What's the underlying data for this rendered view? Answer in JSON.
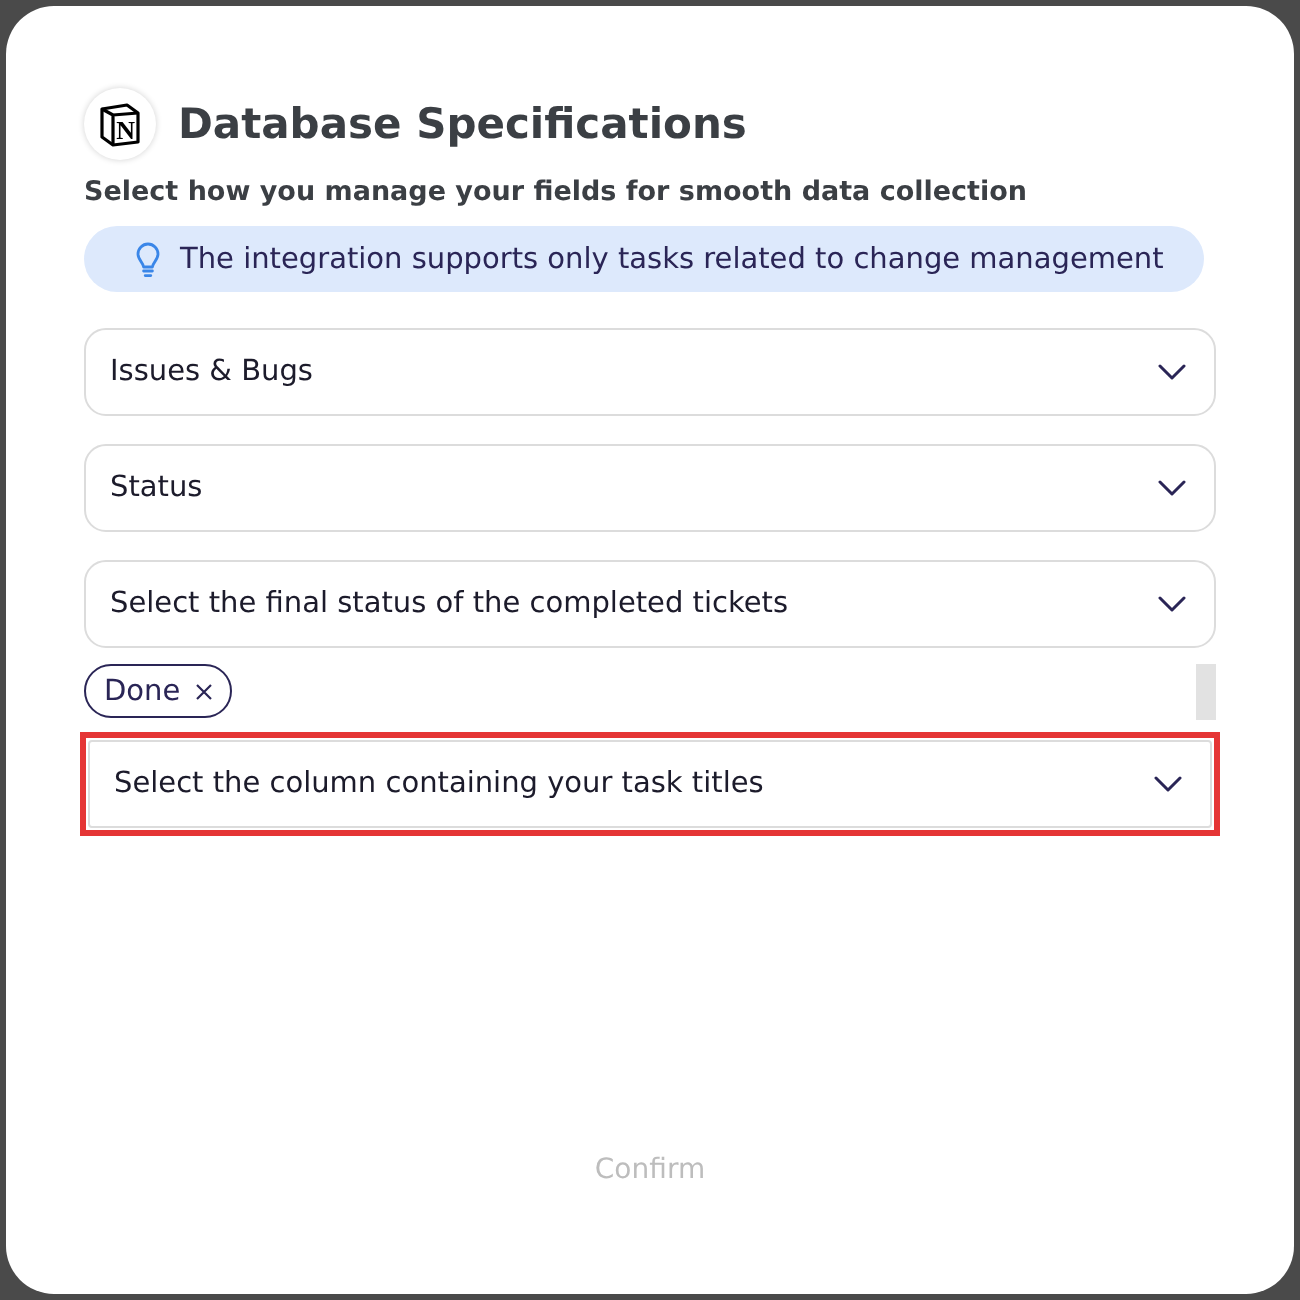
{
  "header": {
    "logo_letter": "N",
    "title": "Database Specifications",
    "subtitle": "Select how you manage your fields for smooth data collection"
  },
  "info_banner": {
    "text": "The integration supports only tasks related to change management"
  },
  "fields": [
    {
      "kind": "dropdown",
      "value": "Issues & Bugs",
      "highlighted": false
    },
    {
      "kind": "dropdown",
      "value": "Status",
      "highlighted": false
    },
    {
      "kind": "dropdown",
      "placeholder": "Select the final status of the completed tickets",
      "highlighted": false,
      "chips": [
        {
          "label": "Done"
        }
      ]
    },
    {
      "kind": "dropdown",
      "placeholder": "Select the column containing your task titles",
      "highlighted": true
    }
  ],
  "confirm_button": {
    "label": "Confirm",
    "disabled": true
  }
}
